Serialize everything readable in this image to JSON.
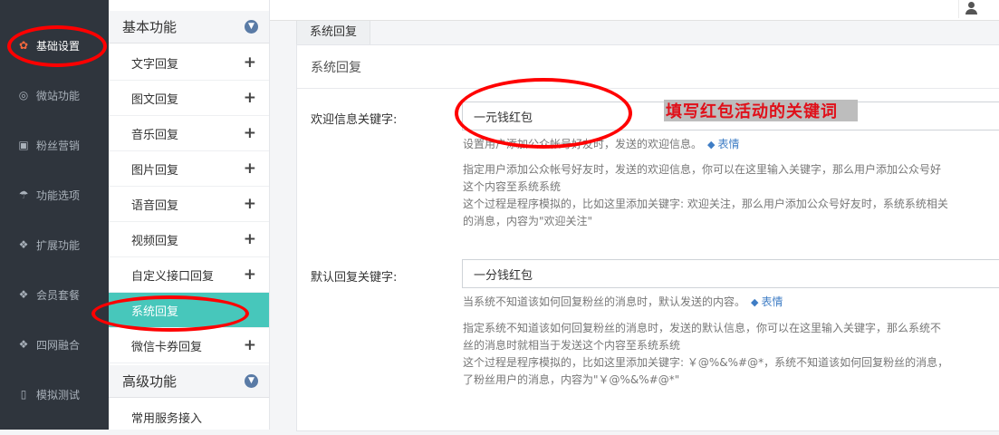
{
  "sidebar": {
    "items": [
      {
        "label": "基础设置",
        "icon": "gear-icon",
        "glyph": "✿"
      },
      {
        "label": "微站功能",
        "icon": "globe-icon",
        "glyph": "◎"
      },
      {
        "label": "粉丝营销",
        "icon": "gift-icon",
        "glyph": "▣"
      },
      {
        "label": "功能选项",
        "icon": "umbrella-icon",
        "glyph": "☂"
      },
      {
        "label": "扩展功能",
        "icon": "cubes-icon",
        "glyph": "❖"
      },
      {
        "label": "会员套餐",
        "icon": "cubes-icon",
        "glyph": "❖"
      },
      {
        "label": "四网融合",
        "icon": "cubes-icon",
        "glyph": "❖"
      },
      {
        "label": "模拟测试",
        "icon": "mobile-icon",
        "glyph": "▯"
      }
    ]
  },
  "submenu": {
    "basic_title": "基本功能",
    "advanced_title": "高级功能",
    "items": [
      "文字回复",
      "图文回复",
      "音乐回复",
      "图片回复",
      "语音回复",
      "视频回复",
      "自定义接口回复",
      "系统回复",
      "微信卡券回复"
    ],
    "plus": "+",
    "advanced_items": [
      "常用服务接入"
    ]
  },
  "main": {
    "tab_label": "系统回复",
    "panel_title": "系统回复",
    "welcome": {
      "label": "欢迎信息关键字:",
      "value": "一元钱红包",
      "help": "设置用户添加公众帐号好友时，发送的欢迎信息。",
      "emoji_label": "表情",
      "note_line1": "指定用户添加公众帐号好友时，发送的欢迎信息，你可以在这里输入关键字，那么用户添加公众号好",
      "note_line2": "这个内容至系统系统",
      "note_line3": "这个过程是程序模拟的，比如这里添加关键字: 欢迎关注，那么用户添加公众号好友时，系统系统相关",
      "note_line4": "的消息，内容为\"欢迎关注\""
    },
    "default": {
      "label": "默认回复关键字:",
      "value": "一分钱红包",
      "help": "当系统不知道该如何回复粉丝的消息时，默认发送的内容。",
      "emoji_label": "表情",
      "note_line1": "指定系统不知道该如何回复粉丝的消息时，发送的默认信息，你可以在这里输入关键字，那么系统不",
      "note_line2": "丝的消息时就相当于发送这个内容至系统系统",
      "note_line3": "这个过程是程序模拟的，比如这里添加关键字: ￥@%&%#@*，系统不知道该如何回复粉丝的消息，",
      "note_line4": "了粉丝用户的消息，内容为\"￥@%&%#@*\""
    }
  },
  "annotation": {
    "text": "填写红包活动的关键词",
    "color": "#e0101a"
  },
  "colors": {
    "sidebar_bg": "#2f353d",
    "active_submenu": "#47c7bb",
    "annotation_ring": "#ff0000"
  }
}
